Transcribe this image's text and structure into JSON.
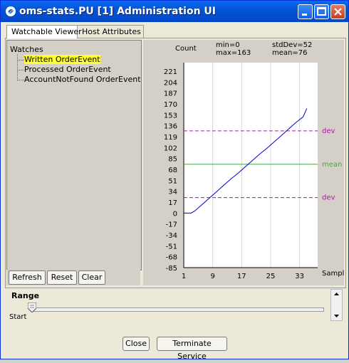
{
  "window": {
    "title": "oms-stats.PU [1] Administration UI",
    "icon": "app-icon"
  },
  "tabs": [
    {
      "label": "Watchable Viewer",
      "active": true
    },
    {
      "label": "Host Attributes",
      "active": false
    }
  ],
  "tree": {
    "root": "Watches",
    "items": [
      {
        "label": "Written OrderEvent",
        "selected": true
      },
      {
        "label": "Processed OrderEvent",
        "selected": false
      },
      {
        "label": "AccountNotFound OrderEvent",
        "selected": false
      }
    ]
  },
  "tree_buttons": {
    "refresh": "Refresh",
    "reset": "Reset",
    "clear": "Clear"
  },
  "stats": {
    "min": "min=0",
    "max": "max=163",
    "stddev": "stdDev=52",
    "mean": "mean=76"
  },
  "chart_data": {
    "type": "line",
    "ylabel": "Count",
    "xlabel": "Sampl",
    "yticks": [
      221,
      204,
      187,
      170,
      153,
      136,
      119,
      102,
      85,
      68,
      51,
      34,
      17,
      0,
      -17,
      -34,
      -51,
      -68,
      -85
    ],
    "xticks": [
      1,
      9,
      17,
      25,
      33
    ],
    "xlim": [
      1,
      38
    ],
    "ylim": [
      -85,
      221
    ],
    "series": [
      {
        "values_x": [
          1,
          3,
          4,
          5,
          6,
          7,
          8,
          10,
          12,
          14,
          16,
          18,
          20,
          22,
          24,
          26,
          28,
          30,
          32,
          34,
          35
        ],
        "values_y": [
          0,
          0,
          3,
          8,
          13,
          18,
          23,
          33,
          43,
          53,
          62,
          72,
          82,
          92,
          101,
          111,
          121,
          131,
          141,
          150,
          163
        ]
      }
    ],
    "reference_lines": [
      {
        "label": "dev",
        "value": 128,
        "color": "#cc00cc",
        "style": "dashed"
      },
      {
        "label": "mean",
        "value": 76,
        "color": "#44aa44",
        "style": "solid"
      },
      {
        "label": "dev",
        "value": 24,
        "color": "#cc00cc",
        "style": "dashed"
      }
    ],
    "line_color": "#0000cc"
  },
  "range": {
    "label": "Range",
    "start_label": "Start",
    "slider_value": 0
  },
  "footer": {
    "close": "Close",
    "terminate": "Terminate Service"
  }
}
